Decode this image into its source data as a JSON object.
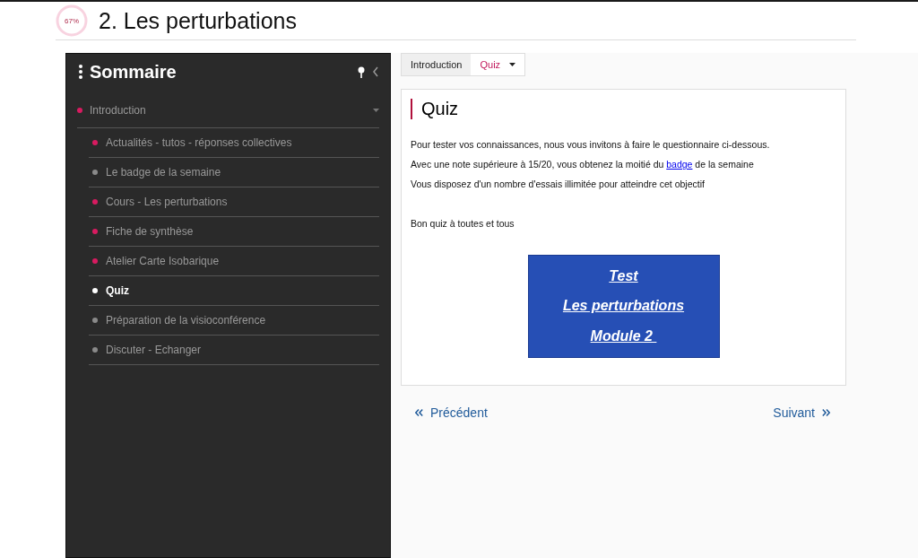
{
  "header": {
    "progress": {
      "label": "67%"
    },
    "title": "2. Les perturbations"
  },
  "sidebar": {
    "title": "Sommaire",
    "section": {
      "label": "Introduction",
      "color": "#d81b60",
      "expanded": true
    },
    "items": [
      {
        "label": "Actualités - tutos - réponses collectives",
        "color": "#d81b60",
        "selected": false
      },
      {
        "label": "Le badge de la semaine",
        "color": "#8a8a8a",
        "selected": false
      },
      {
        "label": "Cours - Les perturbations",
        "color": "#d81b60",
        "selected": false
      },
      {
        "label": "Fiche de synthèse",
        "color": "#d81b60",
        "selected": false
      },
      {
        "label": "Atelier Carte Isobarique",
        "color": "#d81b60",
        "selected": false
      },
      {
        "label": "Quiz",
        "color": "#ffffff",
        "selected": true
      },
      {
        "label": "Préparation de la visioconférence",
        "color": "#8a8a8a",
        "selected": false
      },
      {
        "label": "Discuter - Echanger",
        "color": "#8a8a8a",
        "selected": false
      }
    ]
  },
  "breadcrumb": [
    {
      "label": "Introduction",
      "selected": false
    },
    {
      "label": "Quiz",
      "selected": true
    }
  ],
  "content": {
    "title": "Quiz",
    "paragraphs": [
      {
        "text": "Pour tester vos connaissances, nous vous invitons à faire le questionnaire ci-dessous."
      },
      {
        "text": "Avec une note supérieure à 15/20, vous obtenez la moitié du ",
        "link": "badge",
        "after": " de la semaine"
      },
      {
        "text": "Vous disposez d'un nombre d'essais illimitée pour atteindre cet objectif"
      }
    ],
    "closing": "Bon quiz à toutes et tous",
    "quiz_links": [
      "Test",
      "Les perturbations",
      "Module 2 "
    ]
  },
  "nav": {
    "previous": "Précédent",
    "next": "Suivant"
  }
}
